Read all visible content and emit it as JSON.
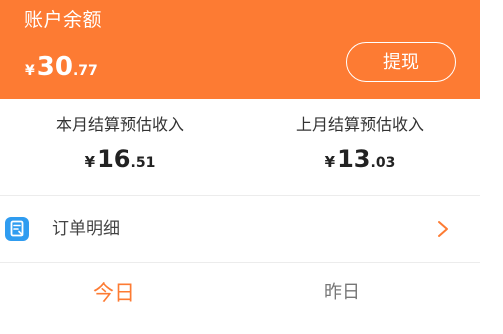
{
  "balance": {
    "title": "账户余额",
    "currency_symbol": "¥",
    "amount_integer": "30",
    "amount_decimal": ".77",
    "withdraw_label": "提现"
  },
  "estimates": [
    {
      "label": "本月结算预估收入",
      "currency_symbol": "¥",
      "amount_integer": "16",
      "amount_decimal": ".51"
    },
    {
      "label": "上月结算预估收入",
      "currency_symbol": "¥",
      "amount_integer": "13",
      "amount_decimal": ".03"
    }
  ],
  "order_detail": {
    "label": "订单明细",
    "icon": "document-icon",
    "arrow_icon": "chevron-right-icon"
  },
  "tabs": [
    {
      "label": "今日",
      "selected": true
    },
    {
      "label": "昨日",
      "selected": false
    }
  ],
  "colors": {
    "accent": "#fd7b33",
    "icon_blue": "#2f9cf0",
    "text_dark": "#333333",
    "text_muted": "#777777"
  }
}
